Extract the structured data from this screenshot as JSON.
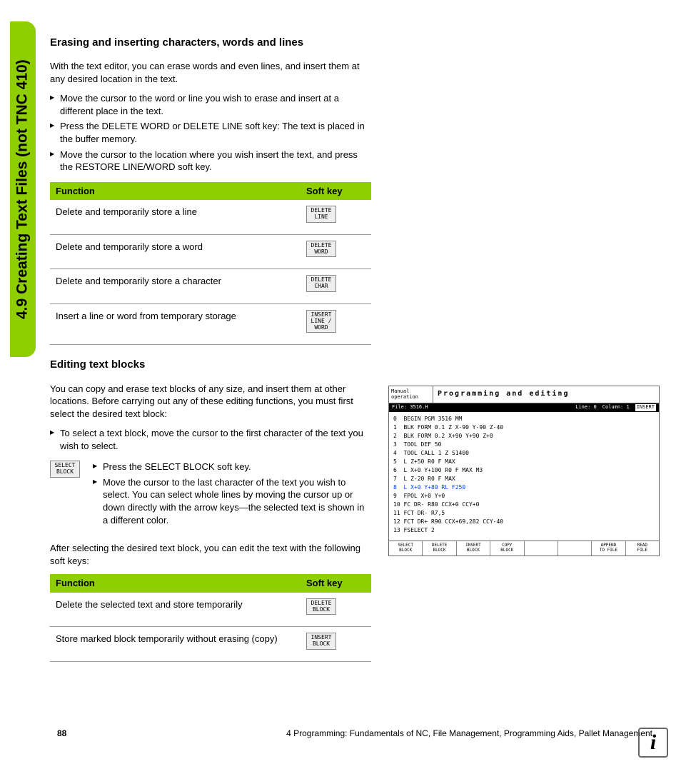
{
  "sideTab": "4.9 Creating Text Files (not TNC 410)",
  "section1": {
    "title": "Erasing and inserting characters, words and lines",
    "intro": "With the text editor, you can erase words and even lines, and insert them at any desired location in the text.",
    "bullets": [
      "Move the cursor to the word or line you wish to erase and insert at a different place in the text.",
      "Press the DELETE WORD or DELETE LINE soft key: The text is placed in the buffer memory.",
      "Move the cursor to the location where you wish insert the text, and press the RESTORE LINE/WORD soft key."
    ],
    "table": {
      "headers": [
        "Function",
        "Soft key"
      ],
      "rows": [
        {
          "fn": "Delete and temporarily store a line",
          "key": "DELETE\nLINE"
        },
        {
          "fn": "Delete and temporarily store a word",
          "key": "DELETE\nWORD"
        },
        {
          "fn": "Delete and temporarily store a character",
          "key": "DELETE\nCHAR"
        },
        {
          "fn": "Insert a line or word from temporary storage",
          "key": "INSERT\nLINE /\nWORD"
        }
      ]
    }
  },
  "section2": {
    "title": "Editing text blocks",
    "intro": "You can copy and erase text blocks of any size, and insert them at other locations. Before carrying out any of these editing functions, you must first select the desired text block:",
    "leadBullet": "To select a text block, move the cursor to the first character of the text you wish to select.",
    "selectKey": "SELECT\nBLOCK",
    "subBullets": [
      "Press the SELECT BLOCK soft key.",
      "Move the cursor to the last character of the text you wish to select. You can select whole lines by moving the cursor up or down directly with the arrow keys—the selected text is shown in a different color."
    ],
    "after": "After selecting the desired text block, you can edit the text with the following soft keys:",
    "table": {
      "headers": [
        "Function",
        "Soft key"
      ],
      "rows": [
        {
          "fn": "Delete the selected text and store temporarily",
          "key": "DELETE\nBLOCK"
        },
        {
          "fn": "Store marked block temporarily without erasing (copy)",
          "key": "INSERT\nBLOCK"
        }
      ]
    }
  },
  "screenshot": {
    "mode": "Manual\noperation",
    "title": "Programming and editing",
    "status": {
      "file": "File: 3516.H",
      "line": "Line: 0",
      "col": "Column: 1",
      "mode": "INSERT"
    },
    "code": [
      "0  BEGIN PGM 3516 MM",
      "1  BLK FORM 0.1 Z X-90 Y-90 Z-40",
      "2  BLK FORM 0.2 X+90 Y+90 Z+0",
      "3  TOOL DEF 50",
      "4  TOOL CALL 1 Z S1400",
      "5  L Z+50 R0 F MAX",
      "6  L X+0 Y+100 R0 F MAX M3",
      "7  L Z-20 R0 F MAX",
      "8  L X+0 Y+80 RL F250",
      "9  FPOL X+0 Y+0",
      "10 FC DR- R80 CCX+0 CCY+0",
      "11 FCT DR- R7,5",
      "12 FCT DR+ R90 CCX+69,282 CCY-40",
      "13 FSELECT 2"
    ],
    "hlIndex": 8,
    "softkeys": [
      "SELECT\nBLOCK",
      "DELETE\nBLOCK",
      "INSERT\nBLOCK",
      "COPY\nBLOCK",
      "",
      "",
      "APPEND\nTO FILE",
      "READ\nFILE"
    ]
  },
  "footer": {
    "page": "88",
    "chapter": "4 Programming: Fundamentals of NC, File Management, Programming Aids, Pallet Management"
  },
  "infoIcon": "i"
}
